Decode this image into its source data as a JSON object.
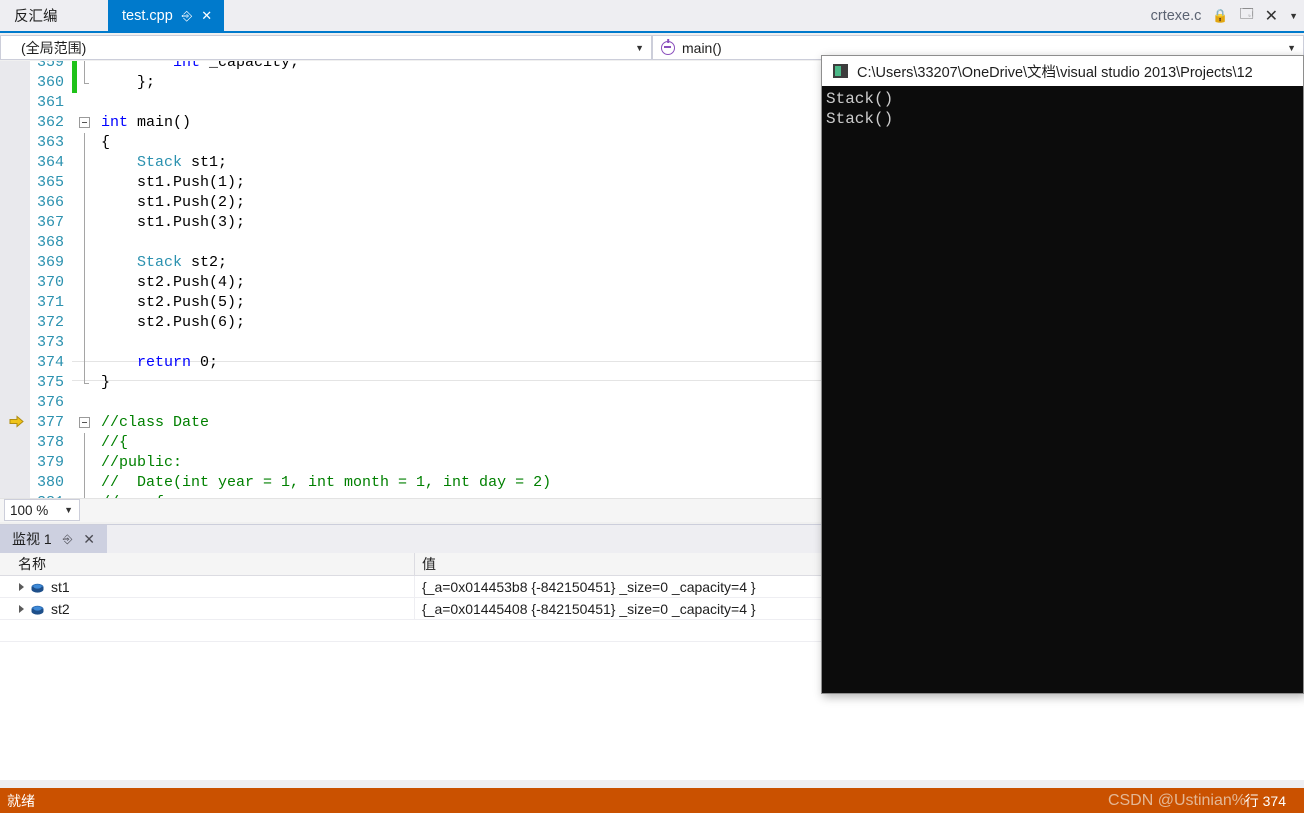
{
  "window": {
    "inactive_tab": "反汇编",
    "active_tab": "test.cpp",
    "tab_pin_icon": "pin-icon",
    "tab_close_icon": "close-icon",
    "right_label": "crtexe.c",
    "right_icons": [
      "lock-icon",
      "restore-icon",
      "close-icon",
      "chevron-down-icon"
    ],
    "accent_color": "#007acc",
    "status_color": "#ca5100"
  },
  "navbar": {
    "scope": "(全局范围)",
    "member": "main()",
    "member_icon": "method-icon",
    "caret_icon": "chevron-down-icon"
  },
  "editor": {
    "zoom_level": "100 %",
    "current_line": 374,
    "exec_arrow_icon": "execution-pointer-icon",
    "lines": [
      {
        "num": "359",
        "text": "        int _capacity;",
        "clipped": true,
        "fold": "line",
        "changed": true,
        "spans": [
          {
            "t": "        ",
            "c": "plain"
          },
          {
            "t": "int",
            "c": "kw"
          },
          {
            "t": " _capacity;",
            "c": "plain"
          }
        ]
      },
      {
        "num": "360",
        "text": "    };",
        "fold": "end",
        "changed": true,
        "spans": [
          {
            "t": "    };",
            "c": "plain"
          }
        ]
      },
      {
        "num": "361",
        "text": "",
        "fold": "none",
        "changed": false,
        "spans": []
      },
      {
        "num": "362",
        "text": "int main()",
        "fold": "box",
        "changed": false,
        "spans": [
          {
            "t": "int",
            "c": "kw"
          },
          {
            "t": " main()",
            "c": "plain"
          }
        ]
      },
      {
        "num": "363",
        "text": "{",
        "fold": "line",
        "changed": false,
        "spans": [
          {
            "t": "{",
            "c": "plain"
          }
        ]
      },
      {
        "num": "364",
        "text": "    Stack st1;",
        "fold": "line",
        "changed": false,
        "spans": [
          {
            "t": "    ",
            "c": "plain"
          },
          {
            "t": "Stack",
            "c": "type"
          },
          {
            "t": " st1;",
            "c": "plain"
          }
        ]
      },
      {
        "num": "365",
        "text": "    st1.Push(1);",
        "fold": "line",
        "changed": false,
        "spans": [
          {
            "t": "    st1.Push(1);",
            "c": "plain"
          }
        ]
      },
      {
        "num": "366",
        "text": "    st1.Push(2);",
        "fold": "line",
        "changed": false,
        "spans": [
          {
            "t": "    st1.Push(2);",
            "c": "plain"
          }
        ]
      },
      {
        "num": "367",
        "text": "    st1.Push(3);",
        "fold": "line",
        "changed": false,
        "spans": [
          {
            "t": "    st1.Push(3);",
            "c": "plain"
          }
        ]
      },
      {
        "num": "368",
        "text": "",
        "fold": "line",
        "changed": false,
        "spans": []
      },
      {
        "num": "369",
        "text": "    Stack st2;",
        "fold": "line",
        "changed": false,
        "spans": [
          {
            "t": "    ",
            "c": "plain"
          },
          {
            "t": "Stack",
            "c": "type"
          },
          {
            "t": " st2;",
            "c": "plain"
          }
        ]
      },
      {
        "num": "370",
        "text": "    st2.Push(4);",
        "fold": "line",
        "changed": false,
        "spans": [
          {
            "t": "    st2.Push(4);",
            "c": "plain"
          }
        ]
      },
      {
        "num": "371",
        "text": "    st2.Push(5);",
        "fold": "line",
        "changed": false,
        "spans": [
          {
            "t": "    st2.Push(5);",
            "c": "plain"
          }
        ]
      },
      {
        "num": "372",
        "text": "    st2.Push(6);",
        "fold": "line",
        "changed": false,
        "spans": [
          {
            "t": "    st2.Push(6);",
            "c": "plain"
          }
        ]
      },
      {
        "num": "373",
        "text": "",
        "fold": "line",
        "changed": false,
        "spans": []
      },
      {
        "num": "374",
        "text": "    return 0;",
        "fold": "line",
        "changed": false,
        "current": true,
        "spans": [
          {
            "t": "    ",
            "c": "plain"
          },
          {
            "t": "return",
            "c": "kw"
          },
          {
            "t": " 0;",
            "c": "plain"
          }
        ]
      },
      {
        "num": "375",
        "text": "}",
        "fold": "end",
        "changed": false,
        "spans": [
          {
            "t": "}",
            "c": "plain"
          }
        ]
      },
      {
        "num": "376",
        "text": "",
        "fold": "none",
        "changed": false,
        "spans": []
      },
      {
        "num": "377",
        "text": "//class Date",
        "fold": "box",
        "changed": false,
        "spans": [
          {
            "t": "//class Date",
            "c": "cmt"
          }
        ]
      },
      {
        "num": "378",
        "text": "//{",
        "fold": "line",
        "changed": false,
        "spans": [
          {
            "t": "//{",
            "c": "cmt"
          }
        ]
      },
      {
        "num": "379",
        "text": "//public:",
        "fold": "line",
        "changed": false,
        "spans": [
          {
            "t": "//public:",
            "c": "cmt"
          }
        ]
      },
      {
        "num": "380",
        "text": "//\tDate(int year = 1, int month = 1, int day = 2)",
        "fold": "line",
        "changed": false,
        "spans": [
          {
            "t": "//  Date(int year = 1, int month = 1, int day = 2)",
            "c": "cmt"
          }
        ]
      },
      {
        "num": "381",
        "text": "//  {",
        "fold": "line",
        "changed": false,
        "clipped_bottom": true,
        "spans": [
          {
            "t": "//    {",
            "c": "cmt"
          }
        ]
      }
    ]
  },
  "watch": {
    "tab_label": "监视 1",
    "pin_icon": "pin-icon",
    "close_icon": "close-icon",
    "columns": [
      "名称",
      "值"
    ],
    "rows": [
      {
        "expander_icon": "expander-triangle-icon",
        "type_icon": "object-icon",
        "name": "st1",
        "value": "{_a=0x014453b8 {-842150451} _size=0 _capacity=4 }"
      },
      {
        "expander_icon": "expander-triangle-icon",
        "type_icon": "object-icon",
        "name": "st2",
        "value": "{_a=0x01445408 {-842150451} _size=0 _capacity=4 }"
      }
    ]
  },
  "console": {
    "icon": "console-app-icon",
    "title": "C:\\Users\\33207\\OneDrive\\文档\\visual studio 2013\\Projects\\12",
    "output": [
      "Stack()",
      "Stack()"
    ]
  },
  "statusbar": {
    "status": "就绪",
    "line_indicator": "行 374",
    "watermark": "CSDN @Ustinian%"
  }
}
